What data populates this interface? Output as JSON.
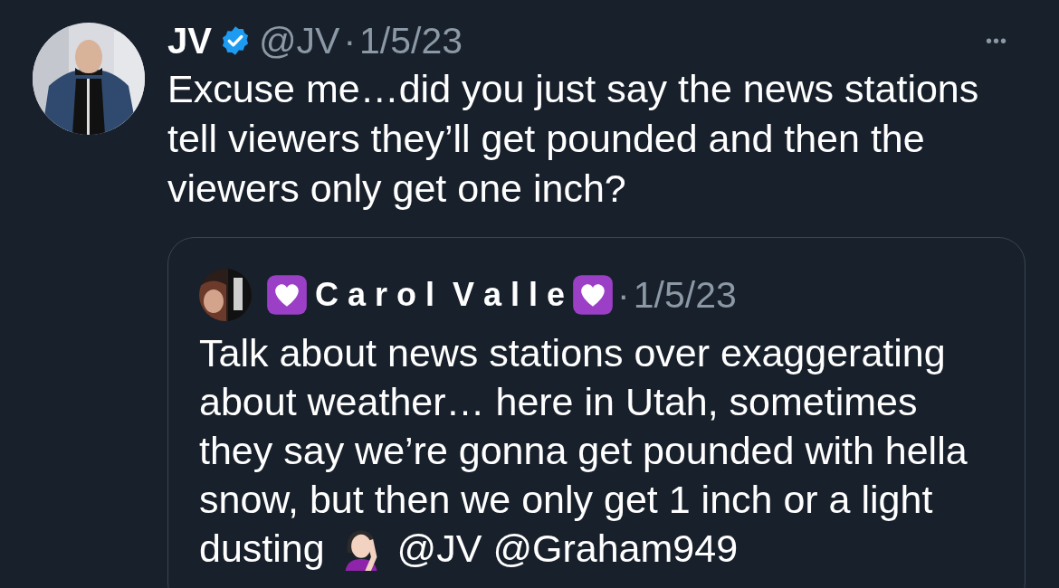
{
  "tweet": {
    "name": "JV",
    "verified": true,
    "handle": "@JV",
    "separator": "·",
    "date": "1/5/23",
    "more": "•••",
    "text": "Excuse me…did you just say the news stations tell viewers they’ll get pounded and then the viewers only get one inch?"
  },
  "quote": {
    "name": "C a r o l  V a l l e",
    "separator": "·",
    "date": "1/5/23",
    "text": "Talk about news stations over exaggerating about weather… here in Utah, sometimes they say we’re gonna get pounded with hella snow, but then we only get 1 inch or a light dusting",
    "mentions": [
      "@JV",
      "@Graham949"
    ]
  }
}
